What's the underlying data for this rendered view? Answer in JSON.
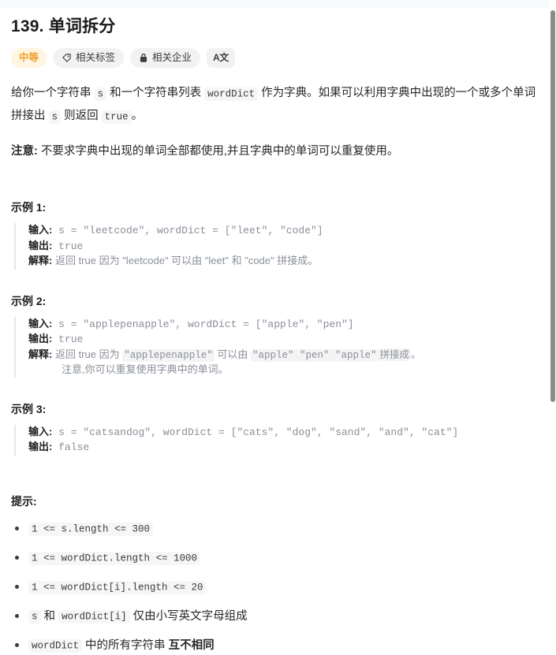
{
  "problem": {
    "title": "139. 单词拆分",
    "badges": [
      {
        "label": "中等",
        "icon": "none",
        "style": "difficulty"
      },
      {
        "label": "相关标签",
        "icon": "tag-icon",
        "style": "pill"
      },
      {
        "label": "相关企业",
        "icon": "lock-icon",
        "style": "pill"
      },
      {
        "label": "A文",
        "icon": "translate-icon",
        "style": "square"
      }
    ],
    "description": {
      "part1": "给你一个字符串 ",
      "code1": "s",
      "part2": " 和一个字符串列表 ",
      "code2": "wordDict",
      "part3": " 作为字典。如果可以利用字典中出现的一个或多个单词拼接出 ",
      "code3": "s",
      "part4": " 则返回 ",
      "code4": "true",
      "part5": "。"
    },
    "note": {
      "label": "注意:",
      "text": " 不要求字典中出现的单词全部都使用,并且字典中的单词可以重复使用。"
    },
    "examples": [
      {
        "heading": "示例 1:",
        "input_label": "输入:",
        "input_value": " s = \"leetcode\", wordDict = [\"leet\", \"code\"]",
        "output_label": "输出:",
        "output_value": " true",
        "explain_label": "解释:",
        "explain_value": " 返回 true 因为 \"leetcode\" 可以由 \"leet\" 和 \"code\" 拼接成。",
        "explain_cont": ""
      },
      {
        "heading": "示例 2:",
        "input_label": "输入:",
        "input_value": " s = \"applepenapple\", wordDict = [\"apple\", \"pen\"]",
        "output_label": "输出:",
        "output_value": " true",
        "explain_label": "解释:",
        "explain_parts": {
          "a": " 返回 true 因为 ",
          "chip1": "\"applepenapple\"",
          "b": " 可以由 ",
          "chip2": "\"apple\" \"pen\" \"apple\"",
          "chip3": "拼接成",
          "c": "。"
        },
        "explain_cont": "注意,你可以重复使用字典中的单词。"
      },
      {
        "heading": "示例 3:",
        "input_label": "输入:",
        "input_value": " s = \"catsandog\", wordDict = [\"cats\", \"dog\", \"sand\", \"and\", \"cat\"]",
        "output_label": "输出:",
        "output_value": " false"
      }
    ],
    "hints": {
      "heading": "提示:",
      "items": [
        {
          "code": "1 <= s.length <= 300",
          "text": "",
          "bold_text": ""
        },
        {
          "code": "1 <= wordDict.length <= 1000",
          "text": "",
          "bold_text": ""
        },
        {
          "code": "1 <= wordDict[i].length <= 20",
          "text": "",
          "bold_text": ""
        },
        {
          "code": "s",
          "mid_text": " 和 ",
          "code2": "wordDict[i]",
          "text": " 仅由小写英文字母组成",
          "bold_text": ""
        },
        {
          "code": "wordDict",
          "text": " 中的所有字符串 ",
          "bold_text": "互不相同"
        }
      ]
    }
  },
  "colors": {
    "difficulty_accent": "#f0a030",
    "code_bg": "#f6f6f6",
    "text": "#262626",
    "muted": "#8a8f98",
    "border": "#e6e6e6"
  }
}
